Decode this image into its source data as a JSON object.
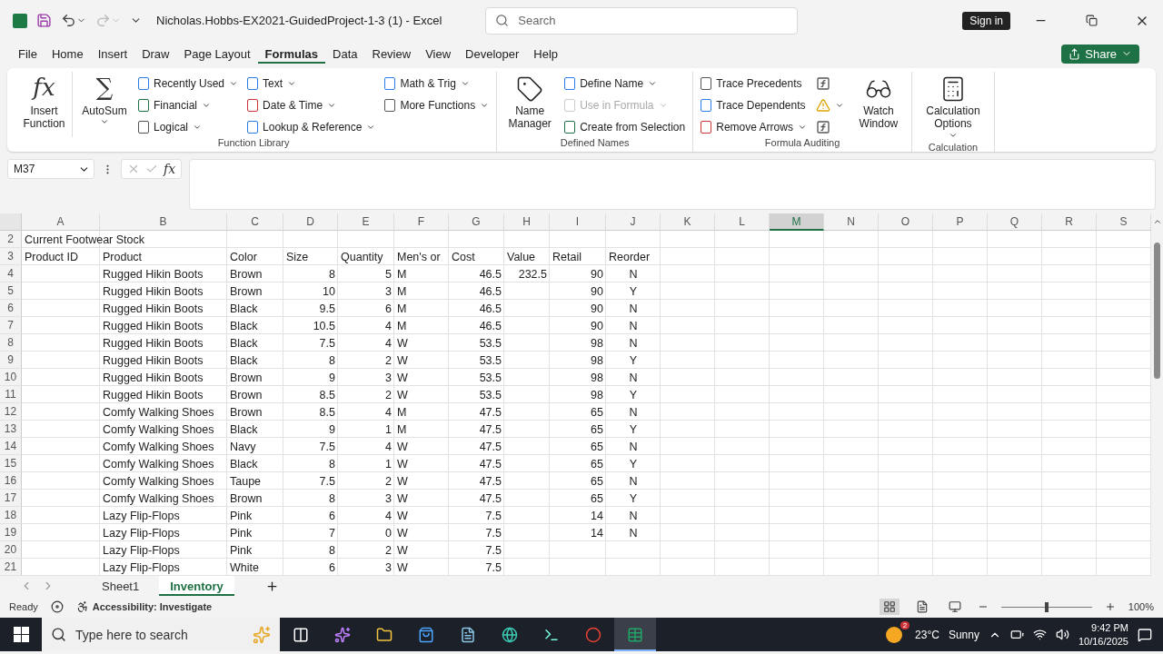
{
  "title_bar": {
    "document_title": "Nicholas.Hobbs-EX2021-GuidedProject-1-3 (1)  -  Excel",
    "search": {
      "placeholder": "Search"
    },
    "sign_in": "Sign in",
    "redo_disabled": true
  },
  "menu_tabs": [
    {
      "label": "File",
      "selected": false
    },
    {
      "label": "Home",
      "selected": false
    },
    {
      "label": "Insert",
      "selected": false
    },
    {
      "label": "Draw",
      "selected": false
    },
    {
      "label": "Page Layout",
      "selected": false
    },
    {
      "label": "Formulas",
      "selected": true
    },
    {
      "label": "Data",
      "selected": false
    },
    {
      "label": "Review",
      "selected": false
    },
    {
      "label": "View",
      "selected": false
    },
    {
      "label": "Developer",
      "selected": false
    },
    {
      "label": "Help",
      "selected": false
    }
  ],
  "share": "Share",
  "ribbon": {
    "groups": [
      {
        "label": "Function Library",
        "items": [
          {
            "kind": "glyph",
            "glyph": "fx",
            "label": "Insert Function",
            "dropdown": false,
            "divider": true
          },
          {
            "kind": "glyph",
            "glyph": "∑",
            "label": "AutoSum",
            "dropdown": true,
            "divider": false
          },
          {
            "kind": "stack",
            "items": [
              {
                "label": "Recently Used",
                "dropdown": true,
                "disabled": false
              },
              {
                "label": "Financial",
                "dropdown": true,
                "disabled": false
              },
              {
                "label": "Logical",
                "dropdown": true,
                "disabled": false
              }
            ]
          },
          {
            "kind": "stack",
            "items": [
              {
                "label": "Text",
                "dropdown": true,
                "disabled": false
              },
              {
                "label": "Date & Time",
                "dropdown": true,
                "disabled": false
              },
              {
                "label": "Lookup & Reference",
                "dropdown": true,
                "disabled": false
              }
            ]
          },
          {
            "kind": "stack",
            "items": [
              {
                "label": "Math & Trig",
                "dropdown": true,
                "disabled": false
              },
              {
                "label": "More Functions",
                "dropdown": true,
                "disabled": false
              }
            ]
          }
        ]
      },
      {
        "label": "Defined Names",
        "items": [
          {
            "kind": "icon",
            "label": "Name Manager",
            "dropdown": false,
            "divider": false
          },
          {
            "kind": "stack",
            "items": [
              {
                "label": "Define Name",
                "dropdown": true,
                "disabled": false
              },
              {
                "label": "Use in Formula",
                "dropdown": true,
                "disabled": true
              },
              {
                "label": "Create from Selection",
                "dropdown": false,
                "disabled": false
              }
            ]
          }
        ]
      },
      {
        "label": "Formula Auditing",
        "items": [
          {
            "kind": "stack",
            "items": [
              {
                "label": "Trace Precedents",
                "dropdown": false,
                "disabled": false
              },
              {
                "label": "Trace Dependents",
                "dropdown": false,
                "disabled": false
              },
              {
                "label": "Remove Arrows",
                "dropdown": true,
                "disabled": false
              }
            ]
          },
          {
            "kind": "icon_stack"
          },
          {
            "kind": "icon",
            "label": "Watch Window",
            "dropdown": false,
            "divider": false
          }
        ]
      },
      {
        "label": "Calculation",
        "items": [
          {
            "kind": "icon",
            "label": "Calculation Options",
            "dropdown": true,
            "divider": false
          }
        ]
      }
    ]
  },
  "formula_bar": {
    "name_box": "M37",
    "fx": "fx"
  },
  "sheet": {
    "columns": [
      {
        "label": "A",
        "kind": "text",
        "selected": false
      },
      {
        "label": "B",
        "kind": "text",
        "selected": false
      },
      {
        "label": "C",
        "kind": "text",
        "selected": false
      },
      {
        "label": "D",
        "kind": "number",
        "selected": false
      },
      {
        "label": "E",
        "kind": "number",
        "selected": false
      },
      {
        "label": "F",
        "kind": "text",
        "selected": false
      },
      {
        "label": "G",
        "kind": "number",
        "selected": false
      },
      {
        "label": "H",
        "kind": "number",
        "selected": false
      },
      {
        "label": "I",
        "kind": "number",
        "selected": false
      },
      {
        "label": "J",
        "kind": "flag",
        "selected": false
      },
      {
        "label": "K",
        "kind": "text",
        "selected": false
      },
      {
        "label": "L",
        "kind": "text",
        "selected": false
      },
      {
        "label": "M",
        "kind": "text",
        "selected": true
      },
      {
        "label": "N",
        "kind": "text",
        "selected": false
      },
      {
        "label": "O",
        "kind": "text",
        "selected": false
      },
      {
        "label": "P",
        "kind": "text",
        "selected": false
      },
      {
        "label": "Q",
        "kind": "text",
        "selected": false
      },
      {
        "label": "R",
        "kind": "text",
        "selected": false
      },
      {
        "label": "S",
        "kind": "text",
        "selected": false
      }
    ],
    "rows": [
      {
        "number": "2",
        "kind": "title",
        "cells": [
          "Current Footwear Stock"
        ]
      },
      {
        "number": "3",
        "kind": "header",
        "cells": [
          "Product ID",
          "Product",
          "Color",
          "Size",
          "Quantity",
          "Men's or",
          "Cost",
          "Value",
          "Retail",
          "Reorder"
        ]
      },
      {
        "number": "4",
        "kind": "data",
        "cells": [
          null,
          "Rugged Hikin Boots",
          "Brown",
          "8",
          "5",
          "M",
          "46.5",
          "232.5",
          "90",
          "N"
        ]
      },
      {
        "number": "5",
        "kind": "data",
        "cells": [
          null,
          "Rugged Hikin Boots",
          "Brown",
          "10",
          "3",
          "M",
          "46.5",
          null,
          "90",
          "Y"
        ]
      },
      {
        "number": "6",
        "kind": "data",
        "cells": [
          null,
          "Rugged Hikin Boots",
          "Black",
          "9.5",
          "6",
          "M",
          "46.5",
          null,
          "90",
          "N"
        ]
      },
      {
        "number": "7",
        "kind": "data",
        "cells": [
          null,
          "Rugged Hikin Boots",
          "Black",
          "10.5",
          "4",
          "M",
          "46.5",
          null,
          "90",
          "N"
        ]
      },
      {
        "number": "8",
        "kind": "data",
        "cells": [
          null,
          "Rugged Hikin Boots",
          "Black",
          "7.5",
          "4",
          "W",
          "53.5",
          null,
          "98",
          "N"
        ]
      },
      {
        "number": "9",
        "kind": "data",
        "cells": [
          null,
          "Rugged Hikin Boots",
          "Black",
          "8",
          "2",
          "W",
          "53.5",
          null,
          "98",
          "Y"
        ]
      },
      {
        "number": "10",
        "kind": "data",
        "cells": [
          null,
          "Rugged Hikin Boots",
          "Brown",
          "9",
          "3",
          "W",
          "53.5",
          null,
          "98",
          "N"
        ]
      },
      {
        "number": "11",
        "kind": "data",
        "cells": [
          null,
          "Rugged Hikin Boots",
          "Brown",
          "8.5",
          "2",
          "W",
          "53.5",
          null,
          "98",
          "Y"
        ]
      },
      {
        "number": "12",
        "kind": "data",
        "cells": [
          null,
          "Comfy Walking Shoes",
          "Brown",
          "8.5",
          "4",
          "M",
          "47.5",
          null,
          "65",
          "N"
        ]
      },
      {
        "number": "13",
        "kind": "data",
        "cells": [
          null,
          "Comfy Walking Shoes",
          "Black",
          "9",
          "1",
          "M",
          "47.5",
          null,
          "65",
          "Y"
        ]
      },
      {
        "number": "14",
        "kind": "data",
        "cells": [
          null,
          "Comfy Walking Shoes",
          "Navy",
          "7.5",
          "4",
          "W",
          "47.5",
          null,
          "65",
          "N"
        ]
      },
      {
        "number": "15",
        "kind": "data",
        "cells": [
          null,
          "Comfy Walking Shoes",
          "Black",
          "8",
          "1",
          "W",
          "47.5",
          null,
          "65",
          "Y"
        ]
      },
      {
        "number": "16",
        "kind": "data",
        "cells": [
          null,
          "Comfy Walking Shoes",
          "Taupe",
          "7.5",
          "2",
          "W",
          "47.5",
          null,
          "65",
          "N"
        ]
      },
      {
        "number": "17",
        "kind": "data",
        "cells": [
          null,
          "Comfy Walking Shoes",
          "Brown",
          "8",
          "3",
          "W",
          "47.5",
          null,
          "65",
          "Y"
        ]
      },
      {
        "number": "18",
        "kind": "data",
        "cells": [
          null,
          "Lazy Flip-Flops",
          "Pink",
          "6",
          "4",
          "W",
          "7.5",
          null,
          "14",
          "N"
        ]
      },
      {
        "number": "19",
        "kind": "data",
        "cells": [
          null,
          "Lazy Flip-Flops",
          "Pink",
          "7",
          "0",
          "W",
          "7.5",
          null,
          "14",
          "N"
        ]
      },
      {
        "number": "20",
        "kind": "data",
        "cells": [
          null,
          "Lazy Flip-Flops",
          "Pink",
          "8",
          "2",
          "W",
          "7.5"
        ]
      },
      {
        "number": "21",
        "kind": "data",
        "cells": [
          null,
          "Lazy Flip-Flops",
          "White",
          "6",
          "3",
          "W",
          "7.5"
        ]
      }
    ]
  },
  "sheet_tabs": [
    {
      "label": "Sheet1",
      "selected": false
    },
    {
      "label": "Inventory",
      "selected": true
    }
  ],
  "status_bar": {
    "mode": "Ready",
    "accessibility": "Accessibility: Investigate",
    "views": [
      {
        "kind": "normal",
        "selected": true
      },
      {
        "kind": "page_layout",
        "selected": false
      },
      {
        "kind": "page_break",
        "selected": false
      }
    ],
    "zoom": {
      "level": 0.5,
      "reading": "100%"
    }
  },
  "taskbar": {
    "search": {
      "placeholder": "Type here to search"
    },
    "apps": [
      {
        "kind": "task_view",
        "active": false
      },
      {
        "kind": "copilot",
        "active": false
      },
      {
        "kind": "files",
        "active": false
      },
      {
        "kind": "store",
        "active": false
      },
      {
        "kind": "notes",
        "active": false
      },
      {
        "kind": "edge",
        "active": false
      },
      {
        "kind": "terminal",
        "active": false
      },
      {
        "kind": "chrome",
        "active": false
      },
      {
        "kind": "excel",
        "active": true
      }
    ],
    "weather": {
      "badge": "2",
      "temperature": "23°C",
      "condition": "Sunny"
    },
    "time": "9:42 PM",
    "date": "10/16/2025"
  }
}
